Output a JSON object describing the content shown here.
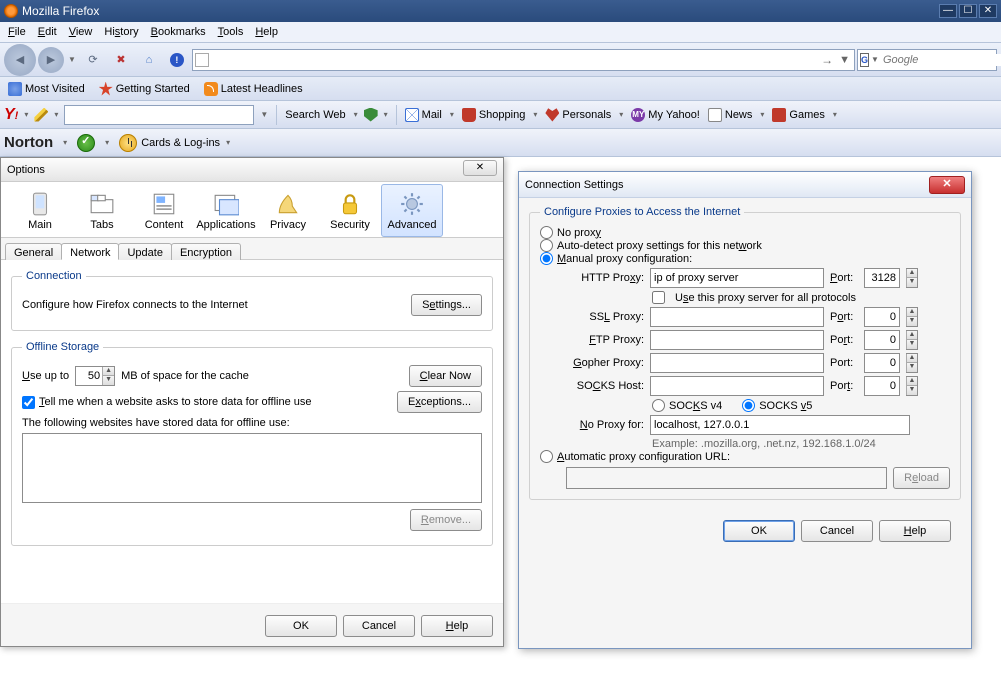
{
  "app": {
    "title": "Mozilla Firefox"
  },
  "menu": {
    "file": "File",
    "edit": "Edit",
    "view": "View",
    "history": "History",
    "bookmarks": "Bookmarks",
    "tools": "Tools",
    "help": "Help"
  },
  "bookmarks": {
    "visited": "Most Visited",
    "started": "Getting Started",
    "headlines": "Latest Headlines"
  },
  "yahoo": {
    "searchweb": "Search Web",
    "mail": "Mail",
    "shopping": "Shopping",
    "personals": "Personals",
    "myyahoo": "My Yahoo!",
    "news": "News",
    "games": "Games"
  },
  "norton": {
    "label": "Norton",
    "cards": "Cards & Log-ins"
  },
  "search": {
    "placeholder": "Google"
  },
  "options": {
    "title": "Options",
    "close": "✕",
    "cats": {
      "main": "Main",
      "tabs": "Tabs",
      "content": "Content",
      "apps": "Applications",
      "privacy": "Privacy",
      "security": "Security",
      "advanced": "Advanced"
    },
    "subtabs": {
      "general": "General",
      "network": "Network",
      "update": "Update",
      "encryption": "Encryption"
    },
    "connection": {
      "legend": "Connection",
      "desc": "Configure how Firefox connects to the Internet",
      "settings": "Settings..."
    },
    "offline": {
      "legend": "Offline Storage",
      "useup": "Use up to",
      "mb": "MB of space for the cache",
      "value": "50",
      "clearnow": "Clear Now",
      "tellme": "Tell me when a website asks to store data for offline use",
      "exceptions": "Exceptions...",
      "following": "The following websites have stored data for offline use:",
      "remove": "Remove..."
    },
    "ok": "OK",
    "cancel": "Cancel",
    "help": "Help"
  },
  "conn": {
    "title": "Connection Settings",
    "legend": "Configure Proxies to Access the Internet",
    "noproxy": "No proxy",
    "autodetect": "Auto-detect proxy settings for this network",
    "manual": "Manual proxy configuration:",
    "http": "HTTP Proxy:",
    "httpval": "ip of proxy server",
    "port": "Port:",
    "httpport": "3128",
    "shared": "Use this proxy server for all protocols",
    "ssl": "SSL Proxy:",
    "ftp": "FTP Proxy:",
    "gopher": "Gopher Proxy:",
    "socks": "SOCKS Host:",
    "zeroport": "0",
    "socksv4": "SOCKS v4",
    "socksv5": "SOCKS v5",
    "noproxyfor": "No Proxy for:",
    "noproxyval": "localhost, 127.0.0.1",
    "example": "Example: .mozilla.org, .net.nz, 192.168.1.0/24",
    "autourl": "Automatic proxy configuration URL:",
    "reload": "Reload",
    "ok": "OK",
    "cancel": "Cancel",
    "help": "Help"
  }
}
